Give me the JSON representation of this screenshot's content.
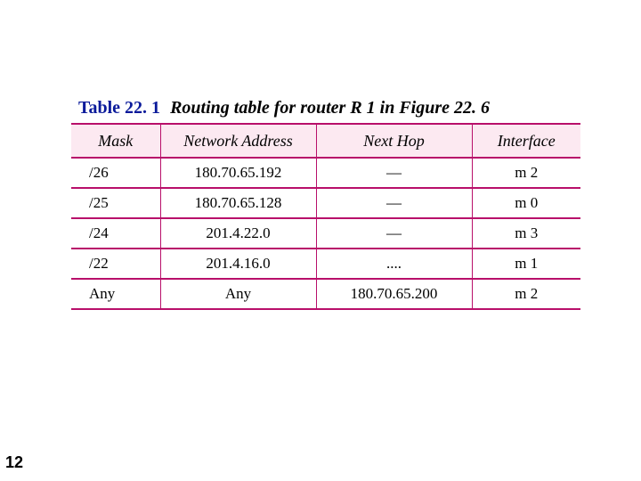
{
  "caption": {
    "label": "Table 22. 1",
    "title": "Routing table for router R 1 in Figure 22. 6"
  },
  "headers": {
    "mask": "Mask",
    "address": "Network Address",
    "nexthop": "Next Hop",
    "iface": "Interface"
  },
  "rows": [
    {
      "mask": "/26",
      "address": "180.70.65.192",
      "nexthop": "—",
      "iface": "m 2"
    },
    {
      "mask": "/25",
      "address": "180.70.65.128",
      "nexthop": "—",
      "iface": "m 0"
    },
    {
      "mask": "/24",
      "address": "201.4.22.0",
      "nexthop": "—",
      "iface": "m 3"
    },
    {
      "mask": "/22",
      "address": "201.4.16.0",
      "nexthop": "....",
      "iface": "m 1"
    },
    {
      "mask": "Any",
      "address": "Any",
      "nexthop": "180.70.65.200",
      "iface": "m 2"
    }
  ],
  "page_number": "12",
  "chart_data": {
    "type": "table",
    "title": "Routing table for router R1 in Figure 22.6",
    "columns": [
      "Mask",
      "Network Address",
      "Next Hop",
      "Interface"
    ],
    "rows": [
      [
        "/26",
        "180.70.65.192",
        "—",
        "m2"
      ],
      [
        "/25",
        "180.70.65.128",
        "—",
        "m0"
      ],
      [
        "/24",
        "201.4.22.0",
        "—",
        "m3"
      ],
      [
        "/22",
        "201.4.16.0",
        "....",
        "m1"
      ],
      [
        "Any",
        "Any",
        "180.70.65.200",
        "m2"
      ]
    ]
  }
}
